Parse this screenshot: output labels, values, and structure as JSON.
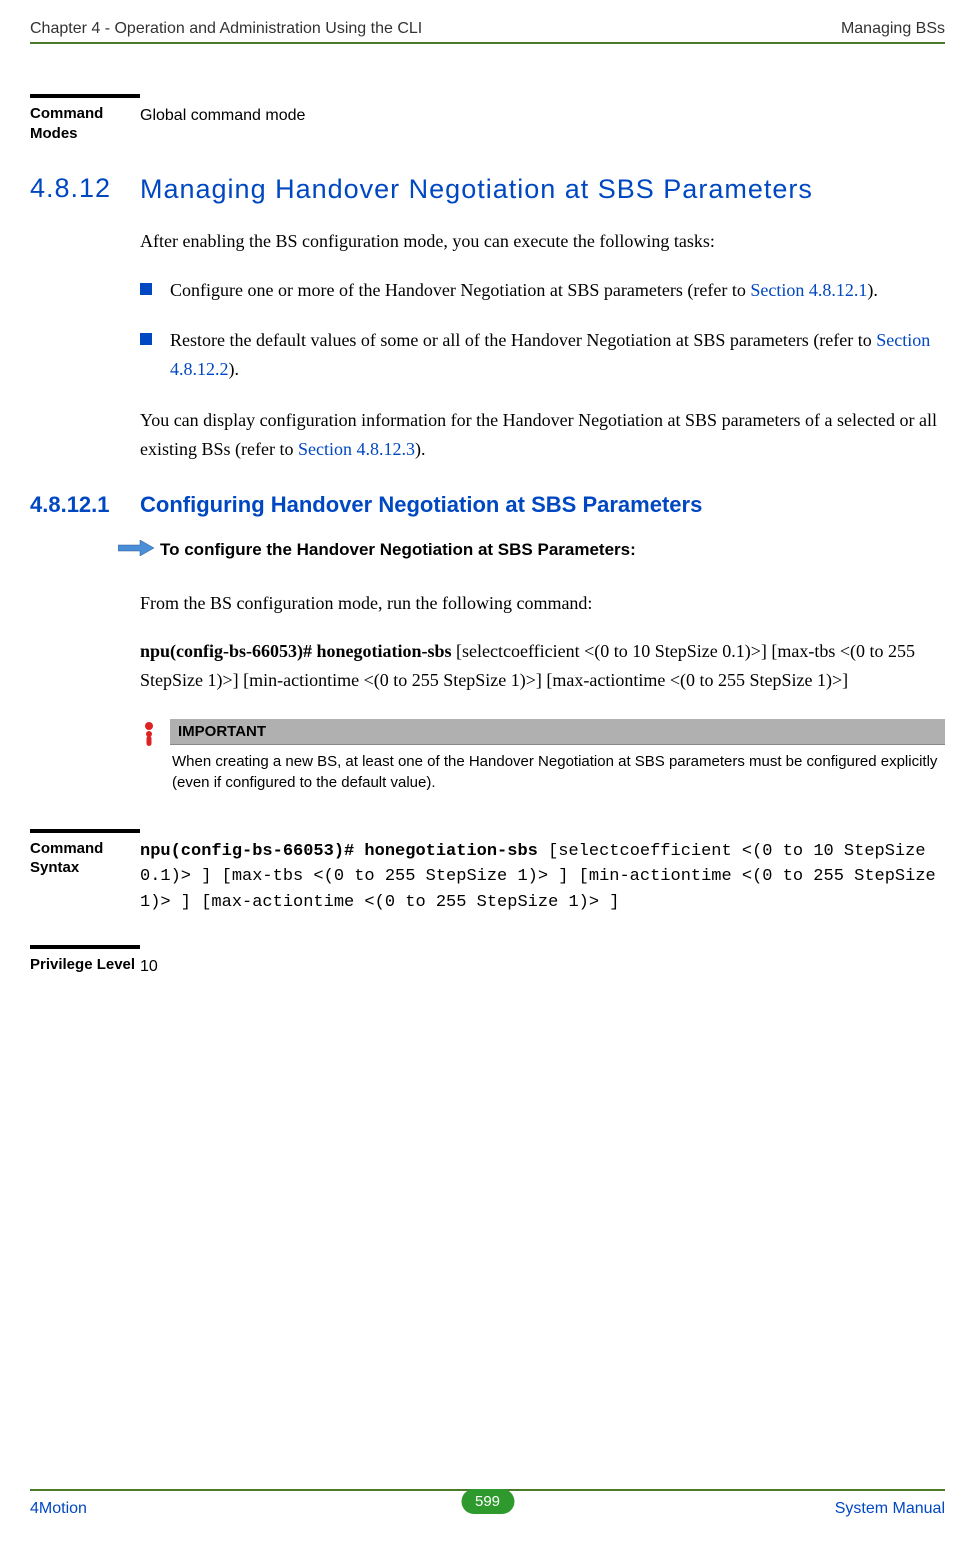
{
  "header": {
    "left": "Chapter 4 - Operation and Administration Using the CLI",
    "right": "Managing BSs"
  },
  "command_modes": {
    "label": "Command Modes",
    "value": "Global command mode"
  },
  "section": {
    "num": "4.8.12",
    "title": "Managing Handover Negotiation at SBS Parameters",
    "intro": "After enabling the BS configuration mode, you can execute the following tasks:",
    "bullets": [
      {
        "text_before": "Configure one or more of the Handover Negotiation at SBS parameters (refer to ",
        "link": "Section 4.8.12.1",
        "text_after": ")."
      },
      {
        "text_before": "Restore the default values of some or all of the Handover Negotiation at SBS parameters (refer to ",
        "link": "Section 4.8.12.2",
        "text_after": ")."
      }
    ],
    "outro_before": "You can display configuration information for the Handover Negotiation at SBS parameters of a selected or all existing BSs (refer to ",
    "outro_link": "Section 4.8.12.3",
    "outro_after": ")."
  },
  "subsection": {
    "num": "4.8.12.1",
    "title": "Configuring Handover Negotiation at SBS Parameters",
    "procedure_label": "To configure the Handover Negotiation at SBS Parameters:",
    "run_text": "From the BS configuration mode, run the following command:",
    "cmd_bold": "npu(config-bs-66053)# honegotiation-sbs",
    "cmd_rest": " [selectcoefficient <(0 to 10 StepSize 0.1)>] [max-tbs <(0 to 255 StepSize 1)>] [min-actiontime <(0 to 255 StepSize 1)>] [max-actiontime <(0 to 255 StepSize 1)>]"
  },
  "important": {
    "header": "IMPORTANT",
    "body": "When creating a new BS, at least one of the Handover Negotiation at SBS parameters must be configured explicitly (even if configured to the default value)."
  },
  "command_syntax": {
    "label": "Command Syntax",
    "bold": "npu(config-bs-66053)# honegotiation-sbs",
    "rest": " [selectcoefficient <(0 to 10 StepSize 0.1)> ] [max-tbs <(0 to 255 StepSize 1)> ] [min-actiontime <(0 to 255 StepSize 1)> ] [max-actiontime <(0 to 255 StepSize 1)> ]"
  },
  "privilege": {
    "label": "Privilege Level",
    "value": "10"
  },
  "footer": {
    "left": "4Motion",
    "page": "599",
    "right": " System Manual"
  }
}
